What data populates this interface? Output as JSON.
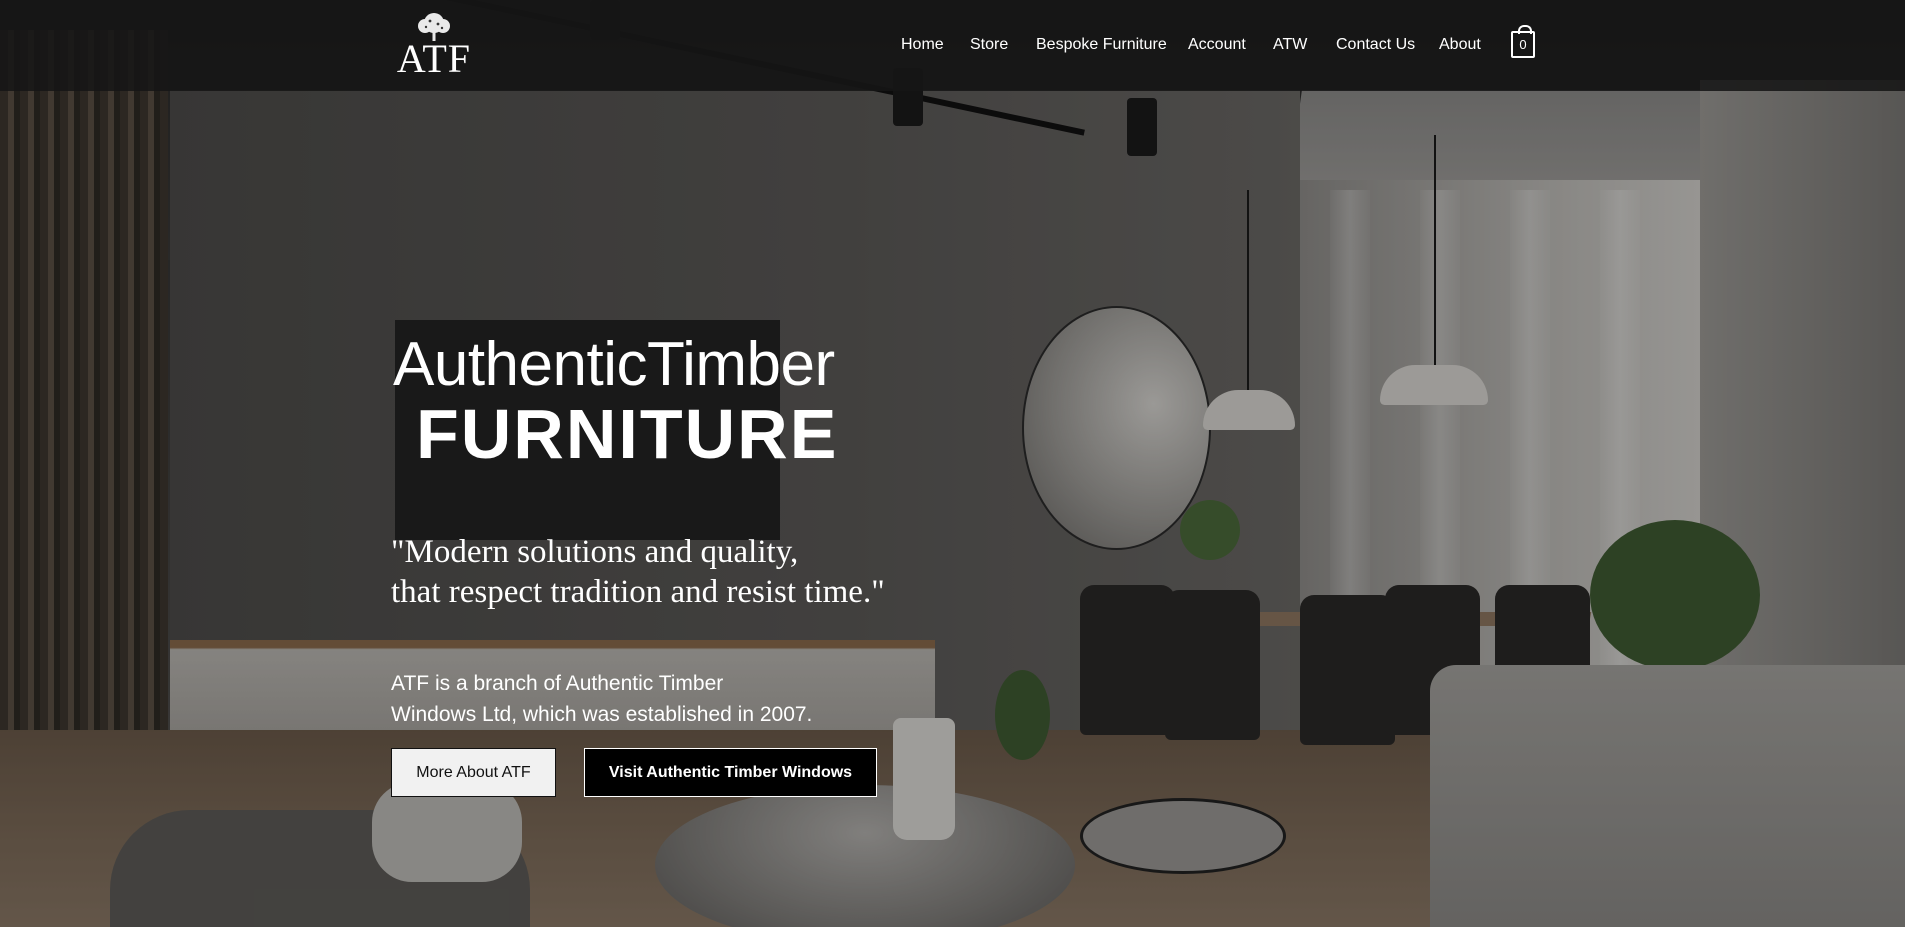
{
  "header": {
    "logo_text": "ATF",
    "nav": [
      {
        "label": "Home"
      },
      {
        "label": "Store"
      },
      {
        "label": "Bespoke Furniture"
      },
      {
        "label": "Account"
      },
      {
        "label": "ATW"
      },
      {
        "label": "Contact Us"
      },
      {
        "label": "About"
      }
    ],
    "cart_count": "0",
    "cart_icon": "shopping-bag-icon"
  },
  "hero": {
    "title_line1": "AuthenticTimber",
    "title_line2": "FURNITURE",
    "quote_line1": "\"Modern solutions and quality,",
    "quote_line2": "that respect tradition and resist time.\"",
    "description_line1": "ATF is a branch of Authentic Timber",
    "description_line2": "Windows Ltd, which was established in 2007.",
    "primary_button": "More About ATF",
    "secondary_button": "Visit Authentic Timber Windows"
  },
  "colors": {
    "header_bg": "#161616",
    "text": "#ffffff",
    "button_light_bg": "#f1f1f1",
    "button_dark_bg": "#000000"
  }
}
